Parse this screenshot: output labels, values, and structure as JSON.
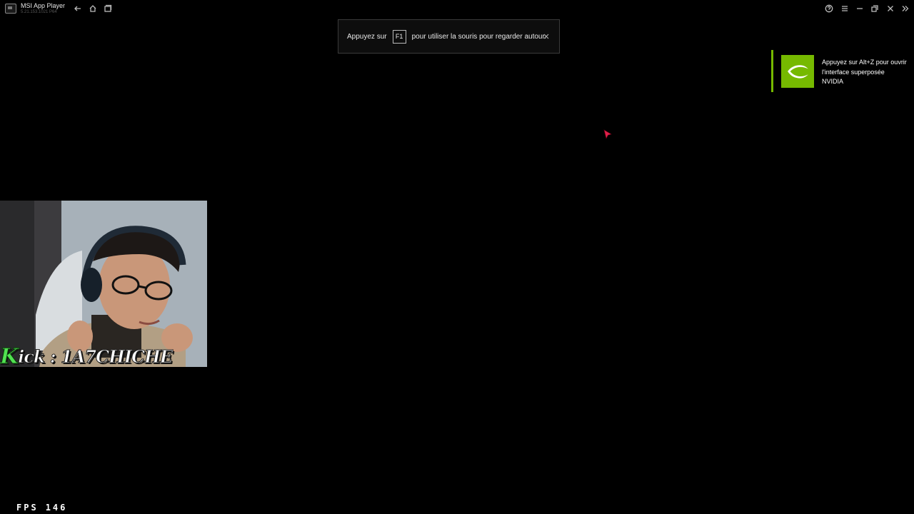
{
  "window": {
    "title": "MSI App Player",
    "version": "5.21.153.1021 P64",
    "buttons": [
      "back-icon",
      "home-icon",
      "multi-instance-icon",
      "help-icon",
      "menu-icon",
      "minimize-icon",
      "restore-icon",
      "close-icon",
      "collapse-sidebar-icon"
    ]
  },
  "toast": {
    "text_before": "Appuyez sur",
    "key": "F1",
    "text_after": "pour utiliser la souris pour regarder autour."
  },
  "nvidia_overlay": {
    "text": "Appuyez sur Alt+Z pour ouvrir l'interface superposée NVIDIA",
    "accent": "#76b900"
  },
  "webcam": {
    "label_k": "K",
    "label_rest": "ick : 1A7CHICHE",
    "label_color": "#52e252"
  },
  "fps": {
    "label": "FPS",
    "value": "146"
  },
  "colors": {
    "background": "#000000",
    "cursor": "#e0204a"
  }
}
